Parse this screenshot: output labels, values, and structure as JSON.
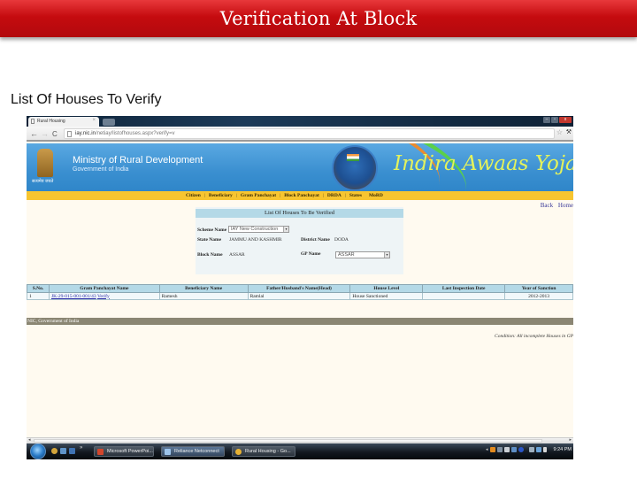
{
  "slide": {
    "title": "Verification At Block",
    "subtitle": "List Of Houses To Verify"
  },
  "browser": {
    "tab_title": "Rural Housing",
    "tab_close": "×",
    "url_host": "iay.nic.in",
    "url_path": "/netiay/listofhouses.aspx?verify=v",
    "back_icon": "←",
    "forward_icon": "→",
    "reload_icon": "C",
    "star_icon": "☆",
    "wrench_icon": "🔧",
    "window_min": "–",
    "window_max": "▫",
    "window_close": "x"
  },
  "site": {
    "emblem_caption": "सत्यमेव जयते",
    "ministry_title": "Ministry of Rural Development",
    "ministry_subtitle": "Government of India",
    "scheme_title": "Indira Awaas Yojana",
    "nav": [
      "Citizen",
      "Beneficiary",
      "Gram Panchayat",
      "Block Panchayat",
      "DRDA",
      "States",
      "MoRD"
    ],
    "nav_separator": "|",
    "top_links": [
      "Back",
      "Home"
    ]
  },
  "filter": {
    "header": "List Of Houses To Be Verified",
    "scheme_label": "Scheme Name",
    "scheme_value": "IAY New Construction",
    "state_label": "State Name",
    "state_value": "JAMMU AND KASHMIR",
    "district_label": "District Name",
    "district_value": "DODA",
    "block_label": "Block Name",
    "block_value": "ASSAR",
    "gp_label": "GP Name",
    "gp_value": "ASSAR",
    "dropdown_icon": "▾"
  },
  "table": {
    "columns": [
      "S.No.",
      "Gram Panchayat Name",
      "Beneficiary Name",
      "Father/Husband's Name(Head)",
      "House Level",
      "Last Inspection Date",
      "Year of Sanction"
    ],
    "rows": [
      {
        "sno": "1",
        "gp_code": "JK-29-015-001-001/43",
        "action": "Verify",
        "beneficiary": "Ramesh",
        "father": "Ramlal",
        "house_level": "House Sanctioned",
        "last_inspection": "",
        "year": "2012-2013"
      }
    ]
  },
  "footer": {
    "text": "NIC, Government of India",
    "condition": "Condition: All incomplete Houses in GP"
  },
  "taskbar": {
    "more_icon": "»",
    "tasks": [
      "Microsoft PowerPoi...",
      "Reliance Netconnect",
      "Rural Housing - Go..."
    ],
    "clock": "9:24 PM",
    "tray_arrow": "◂"
  },
  "scrollbar": {
    "left_arrow": "◂",
    "right_arrow": "▸"
  }
}
